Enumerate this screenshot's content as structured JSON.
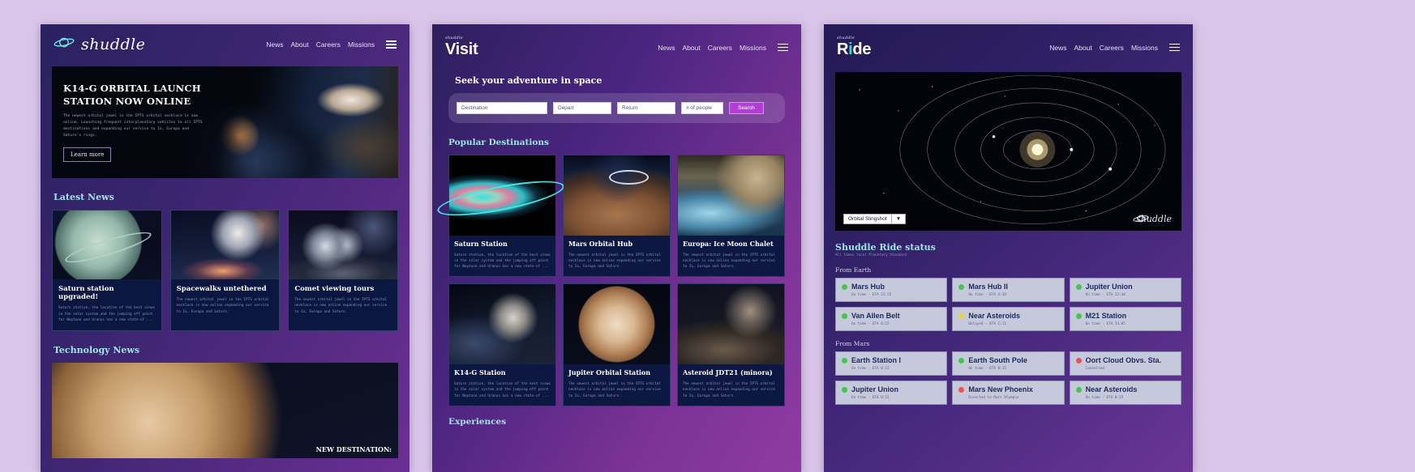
{
  "news_site": {
    "brand": {
      "word": "shuddle",
      "icon": "saturn-icon"
    },
    "nav": [
      "News",
      "About",
      "Careers",
      "Missions"
    ],
    "hero": {
      "title": "K14-G ORBITAL LAUNCH STATION NOW ONLINE",
      "body": "The newest orbital jewel in the IPTS orbital necklace is now online. Launching frequent interplanetary vehicles to all IPTS destinations and expanding our service to Io, Europa and Saturn's rings.",
      "button": "Learn more"
    },
    "latest_news_title": "Latest News",
    "news_cards": [
      {
        "title": "Saturn station upgraded!",
        "text": "Saturn station, the location of the best views in the solar system and the jumping off point for Neptune and Uranus has a new state-of ...",
        "image": "saturn-planet-image"
      },
      {
        "title": "Spacewalks untethered",
        "text": "The newest orbital jewel in the IPTS orbital necklace is now online expanding our service to Io, Europa and Saturn.",
        "image": "astronaut-spacewalk-image"
      },
      {
        "title": "Comet viewing tours",
        "text": "The newest orbital jewel in the IPTS orbital necklace is now online expanding our service to Io, Europa and Saturn.",
        "image": "astronauts-on-comet-image"
      }
    ],
    "tech_news_title": "Technology News",
    "tech_caption": "NEW DESTINATION:"
  },
  "visit_site": {
    "brand": {
      "small": "shuddle",
      "big": "Visit"
    },
    "nav": [
      "News",
      "About",
      "Careers",
      "Missions"
    ],
    "heading": "Seek your adventure in space",
    "search": {
      "destination_placeholder": "Destination",
      "depart_placeholder": "Depart",
      "return_placeholder": "Return",
      "people_placeholder": "# of people",
      "button": "Search"
    },
    "popular_title": "Popular Destinations",
    "destinations": [
      {
        "title": "Saturn Station",
        "text": "Saturn station, the location of the best views in the solar system and the jumping off point for Neptune and Uranus has a new state-of ...",
        "image": "saturn-rings-image"
      },
      {
        "title": "Mars Orbital Hub",
        "text": "The newest orbital jewel in the IPTS orbital necklace is now online expanding our service to Io, Europa and Saturn.",
        "image": "mars-orbital-station-image"
      },
      {
        "title": "Europa: Ice Moon Chalet",
        "text": "The newest orbital jewel in the IPTS orbital necklace is now online expanding our service to Io, Europa and Saturn.",
        "image": "europa-ice-image"
      },
      {
        "title": "K14-G Station",
        "text": "Saturn station, the location of the best views in the solar system and the jumping off point for Neptune and Uranus has a new state-of ...",
        "image": "k14g-station-image"
      },
      {
        "title": "Jupiter Orbital Station",
        "text": "The newest orbital jewel in the IPTS orbital necklace is now online expanding our service to Io, Europa and Saturn.",
        "image": "jupiter-planet-image"
      },
      {
        "title": "Asteroid JDT21 (minora)",
        "text": "The newest orbital jewel in the IPTS orbital necklace is now online expanding our service to Io, Europa and Saturn.",
        "image": "asteroid-astronauts-image"
      }
    ],
    "experiences_title": "Experiences"
  },
  "ride_site": {
    "brand": {
      "small": "shuddle",
      "big": "Ride"
    },
    "nav": [
      "News",
      "About",
      "Careers",
      "Missions"
    ],
    "map": {
      "route_select_value": "Orbital Slingshot",
      "watermark": "shuddle"
    },
    "status_title": "Shuddle Ride status",
    "status_sub": "All times local Planetary Standard",
    "groups": [
      {
        "label": "From Earth",
        "rows": [
          {
            "name": "Mars Hub",
            "meta": "On time - ETA 21:25",
            "led": "#43c64a"
          },
          {
            "name": "Mars Hub II",
            "meta": "On time - ETA 4:18",
            "led": "#43c64a"
          },
          {
            "name": "Jupiter Union",
            "meta": "On time - ETA 12:44",
            "led": "#43c64a"
          },
          {
            "name": "Van Allen Belt",
            "meta": "On time - ETA 0:15",
            "led": "#43c64a"
          },
          {
            "name": "Near Asteroids",
            "meta": "Delayed - ETA 1:11",
            "led": "#ecd13f"
          },
          {
            "name": "M21 Station",
            "meta": "On time - ETA 14:05",
            "led": "#43c64a"
          }
        ]
      },
      {
        "label": "From Mars",
        "rows": [
          {
            "name": "Earth Station I",
            "meta": "On time - ETA 0:15",
            "led": "#43c64a"
          },
          {
            "name": "Earth South Pole",
            "meta": "On time - ETA 0:15",
            "led": "#43c64a"
          },
          {
            "name": "Oort Cloud Obvs. Sta.",
            "meta": "Cancelled",
            "led": "#ef5350"
          },
          {
            "name": "Jupiter Union",
            "meta": "On time - ETA 0:15",
            "led": "#43c64a"
          },
          {
            "name": "Mars New Phoenix",
            "meta": "Diverted to Mars Olympus",
            "led": "#ef5350"
          },
          {
            "name": "Near Asteroids",
            "meta": "On time - ETA 0:15",
            "led": "#43c64a"
          }
        ]
      }
    ]
  }
}
